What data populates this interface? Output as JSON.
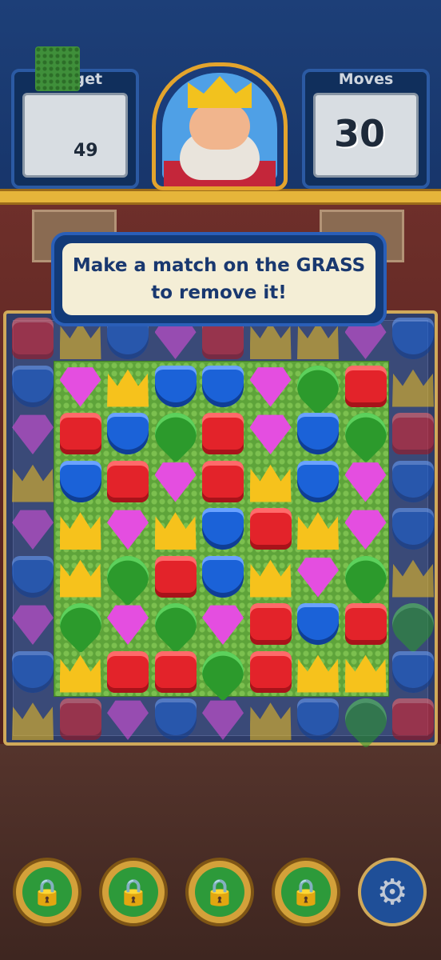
{
  "hud": {
    "target": {
      "title": "Target",
      "count": "49",
      "icon": "grass-tile-icon"
    },
    "moves": {
      "title": "Moves",
      "value": "30"
    },
    "portrait": {
      "icon": "king-portrait-icon"
    }
  },
  "tooltip": {
    "line1": "Make a match on the GRASS",
    "line2": "to remove it!"
  },
  "board": {
    "rows": [
      [
        "red",
        "gold",
        "blue",
        "purple",
        "red",
        "gold",
        "gold",
        "purple",
        "blue"
      ],
      [
        "blue",
        "purple",
        "gold",
        "blue",
        "blue",
        "purple",
        "green",
        "red",
        "gold"
      ],
      [
        "purple",
        "red",
        "blue",
        "green",
        "red",
        "purple",
        "blue",
        "green",
        "red"
      ],
      [
        "gold",
        "blue",
        "red",
        "purple",
        "red",
        "gold",
        "blue",
        "purple",
        "blue"
      ],
      [
        "purple",
        "gold",
        "purple",
        "gold",
        "blue",
        "red",
        "gold",
        "purple",
        "blue"
      ],
      [
        "blue",
        "gold",
        "green",
        "red",
        "blue",
        "gold",
        "purple",
        "green",
        "gold"
      ],
      [
        "purple",
        "green",
        "purple",
        "green",
        "purple",
        "red",
        "blue",
        "red",
        "green"
      ],
      [
        "blue",
        "gold",
        "red",
        "red",
        "green",
        "red",
        "gold",
        "gold",
        "blue"
      ],
      [
        "gold",
        "red",
        "purple",
        "blue",
        "purple",
        "gold",
        "blue",
        "green",
        "red"
      ]
    ],
    "grass_region": "rows 2-8, columns 2-8"
  },
  "boosters": [
    {
      "icon": "lock-icon",
      "locked": true
    },
    {
      "icon": "lock-icon",
      "locked": true
    },
    {
      "icon": "lock-icon",
      "locked": true
    },
    {
      "icon": "lock-icon",
      "locked": true
    }
  ],
  "settings": {
    "icon": "gear-icon"
  }
}
